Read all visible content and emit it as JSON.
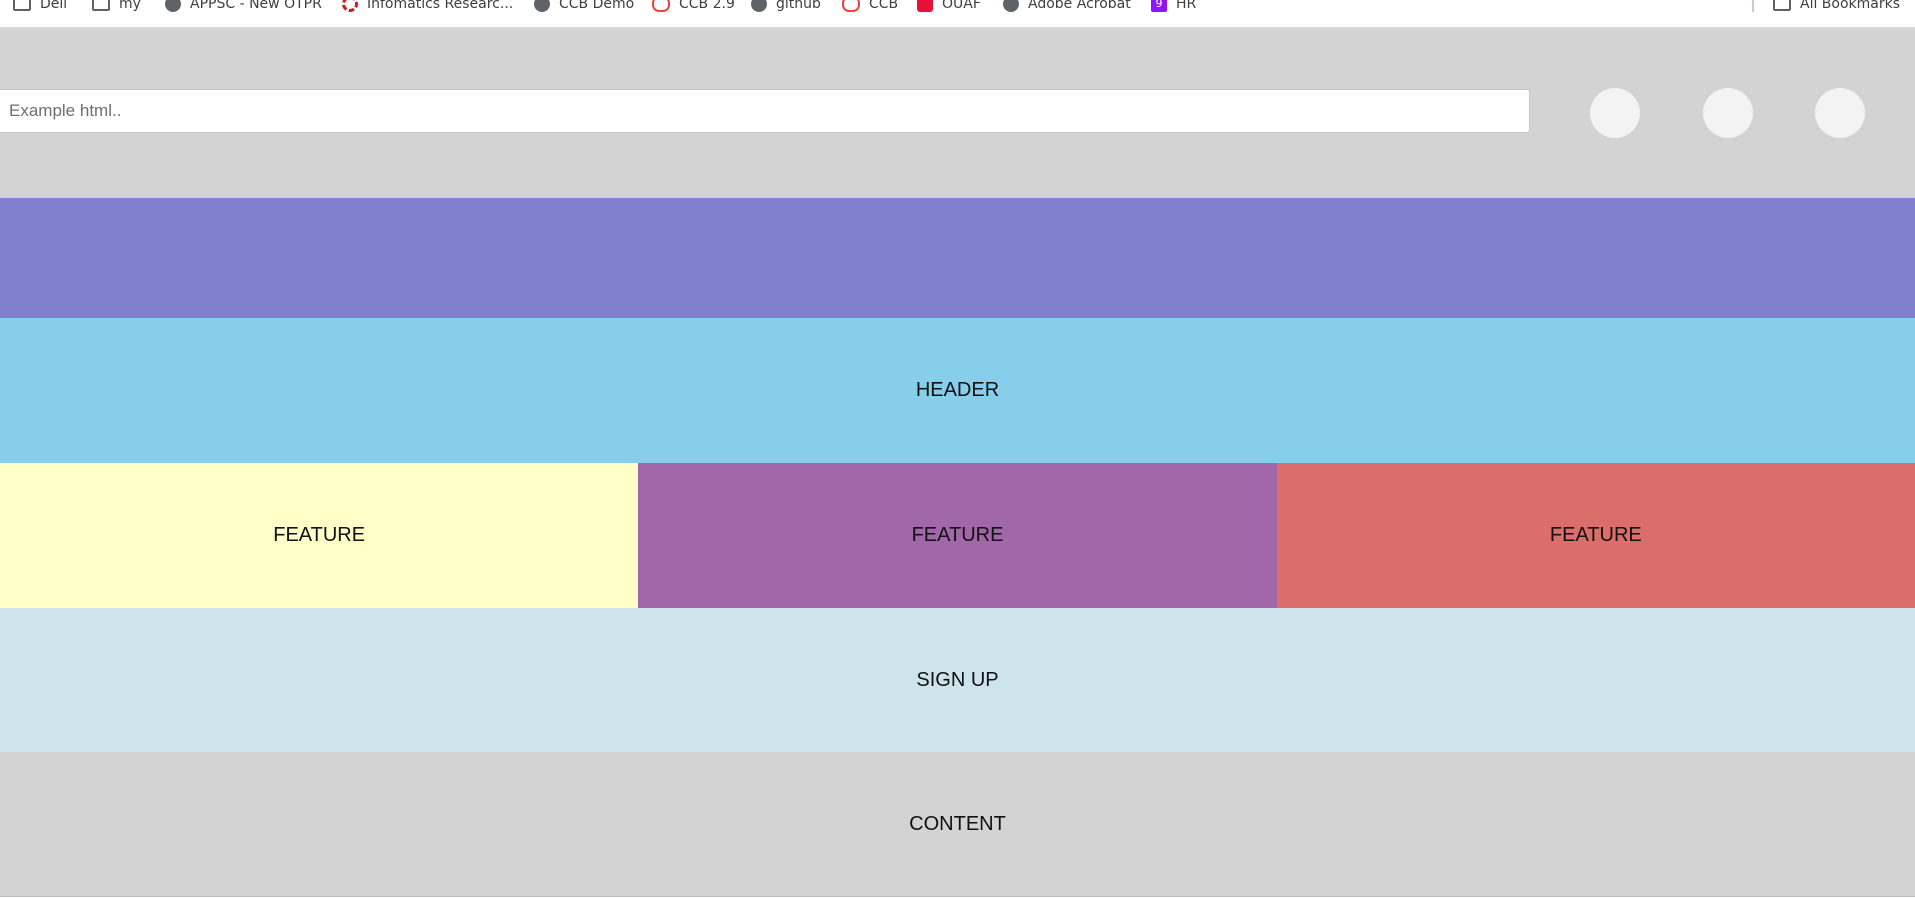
{
  "bookmarks": [
    {
      "label": "Dell",
      "icon": "folder-icon"
    },
    {
      "label": "my",
      "icon": "folder-icon"
    },
    {
      "label": "APPSC - New OTPR",
      "icon": "globe-icon"
    },
    {
      "label": "Infomatics Researc...",
      "icon": "informatics-icon"
    },
    {
      "label": "CCB Demo",
      "icon": "globe-icon"
    },
    {
      "label": "CCB 2.9",
      "icon": "cloud-icon"
    },
    {
      "label": "github",
      "icon": "globe-icon"
    },
    {
      "label": "CCB",
      "icon": "cloud-icon"
    },
    {
      "label": "OUAF",
      "icon": "oracle-icon"
    },
    {
      "label": "Adobe Acrobat",
      "icon": "globe-icon"
    },
    {
      "label": "HR",
      "icon": "hr-icon"
    }
  ],
  "all_bookmarks": {
    "label": "All Bookmarks",
    "icon": "folder-icon"
  },
  "search": {
    "placeholder": "Example html.."
  },
  "sections": {
    "header": "HEADER",
    "features": [
      {
        "label": "FEATURE",
        "color": "#ffffc8"
      },
      {
        "label": "FEATURE",
        "color": "#a267a9"
      },
      {
        "label": "FEATURE",
        "color": "#db6d6b"
      }
    ],
    "signup": "SIGN UP",
    "content": "CONTENT"
  },
  "colors": {
    "topbar": "#d3d3d3",
    "nav": "#8080cf",
    "header": "#87ceeb",
    "signup": "#cee4ec",
    "content": "#d3d3d3"
  }
}
